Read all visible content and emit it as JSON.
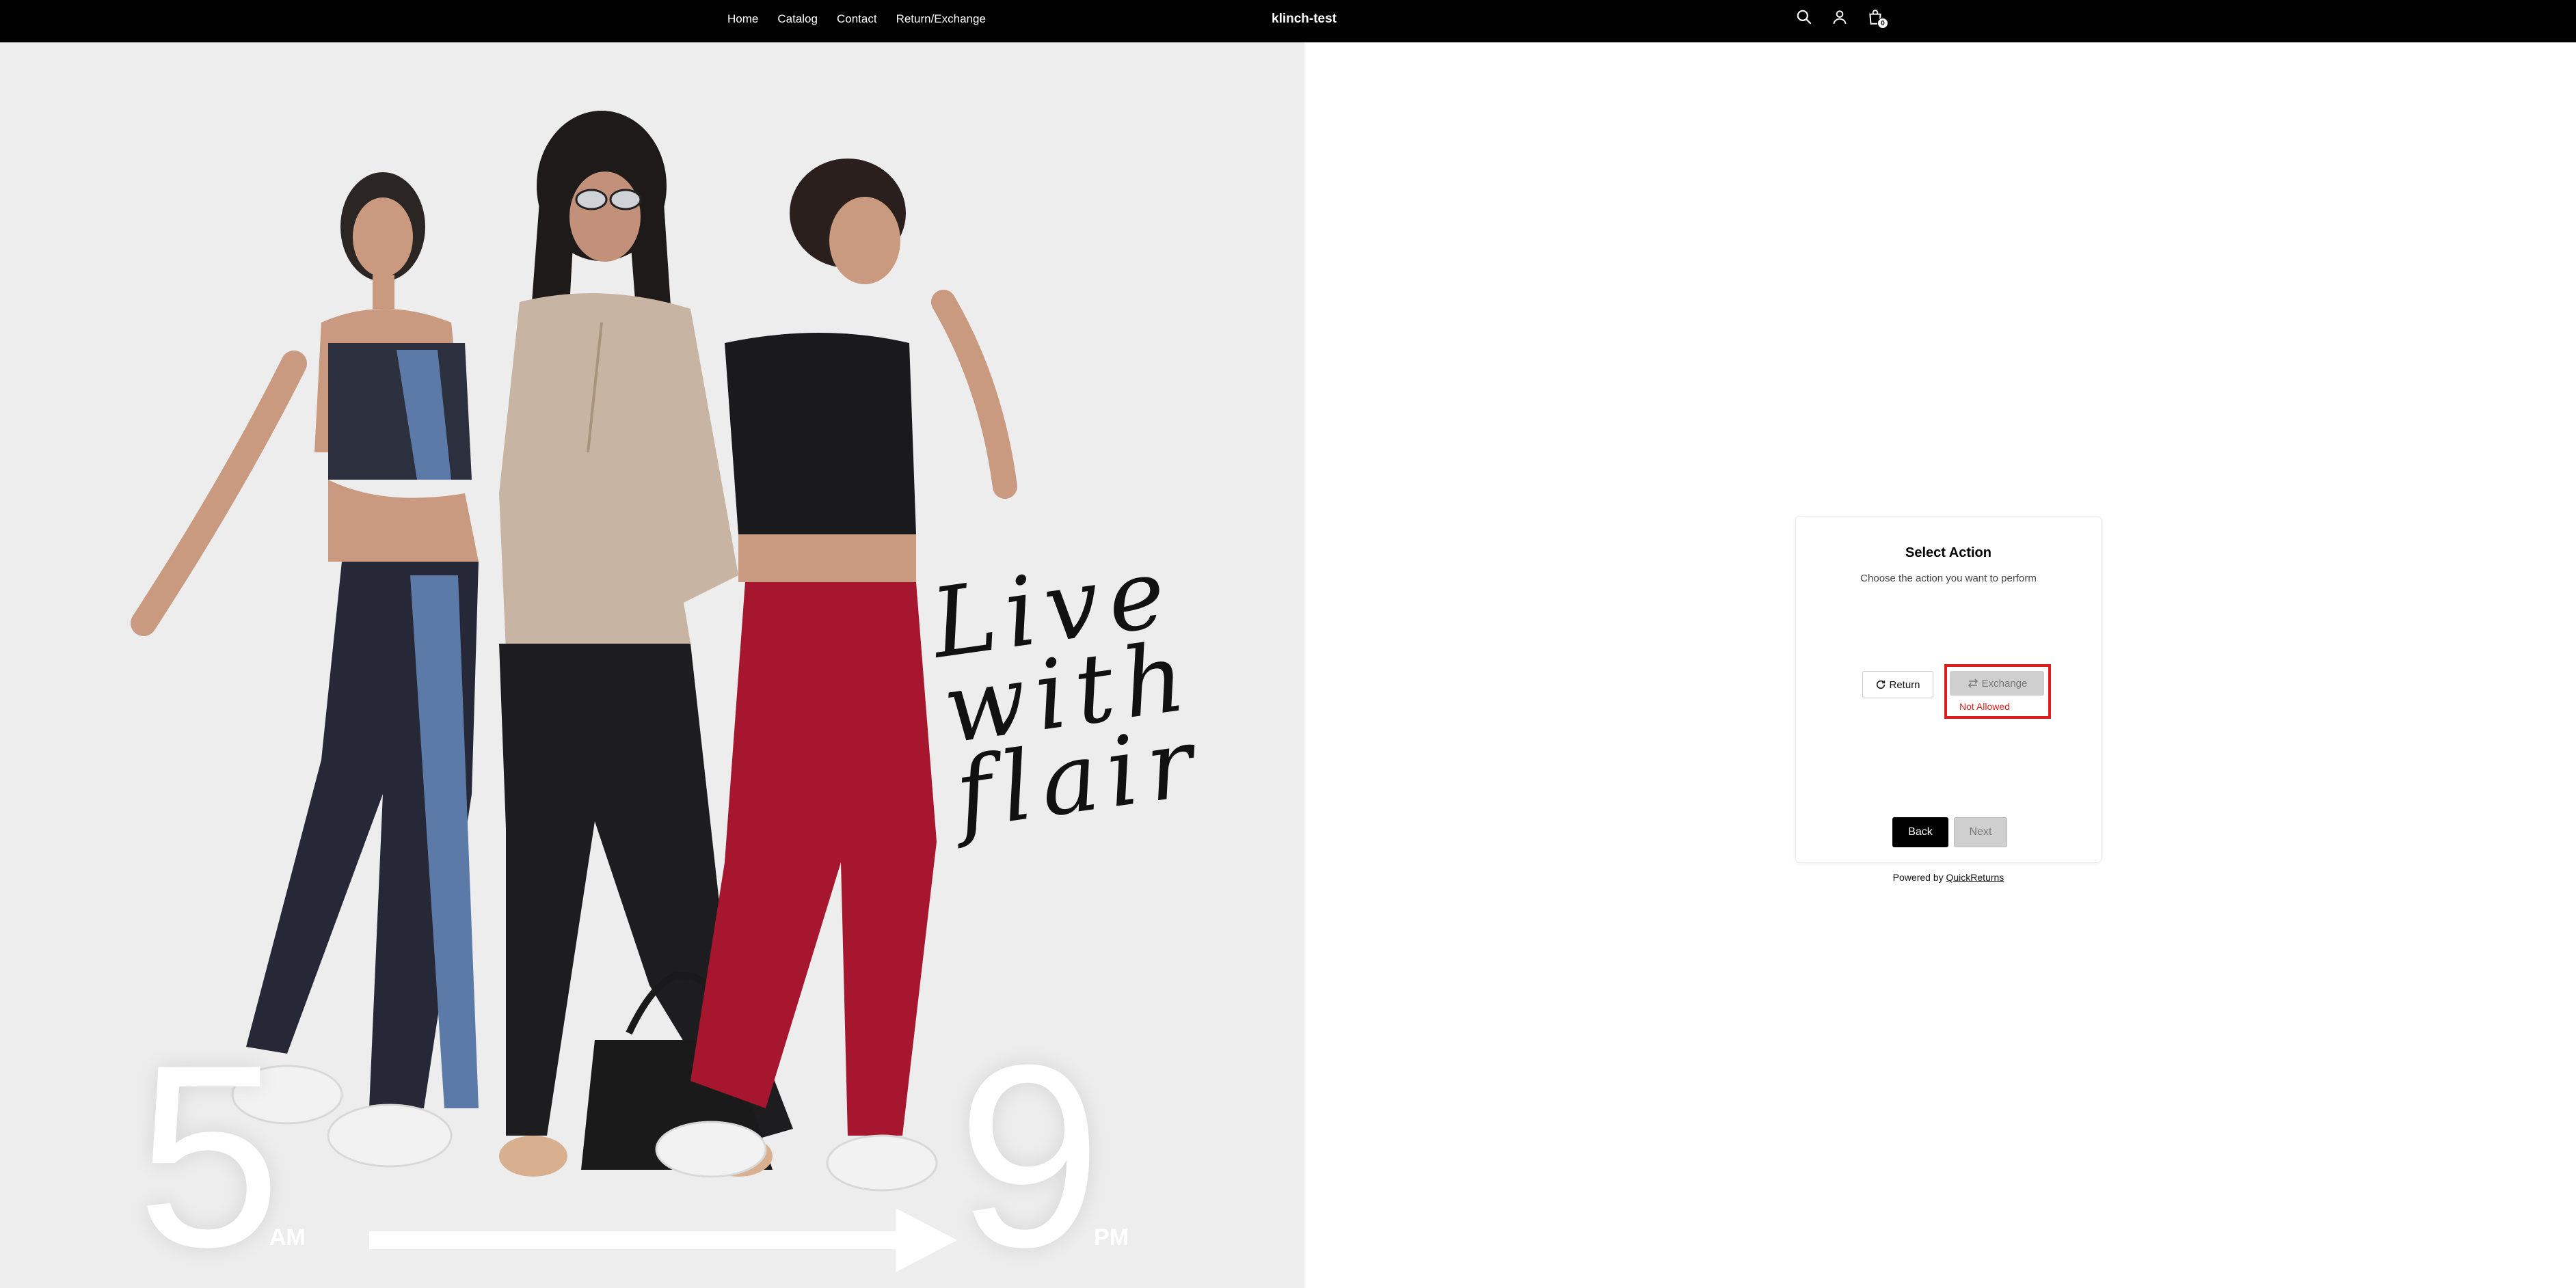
{
  "header": {
    "nav": [
      {
        "label": "Home"
      },
      {
        "label": "Catalog"
      },
      {
        "label": "Contact"
      },
      {
        "label": "Return/Exchange"
      }
    ],
    "brand": "klinch-test",
    "icons": [
      "search-icon",
      "account-icon",
      "cart-icon"
    ],
    "cart_count": "0"
  },
  "hero": {
    "script_text": [
      "Live",
      "with",
      "flair"
    ],
    "start_number": "5",
    "start_suffix": "AM",
    "end_number": "9",
    "end_suffix": "PM"
  },
  "modal": {
    "title": "Select Action",
    "subtitle": "Choose the action you want to perform",
    "return_label": "Return",
    "exchange_label": "Exchange",
    "exchange_status": "Not Allowed",
    "back_label": "Back",
    "next_label": "Next",
    "status_color": "#e01d1d"
  },
  "footer": {
    "powered_by": "Powered by",
    "powered_link": "QuickReturns"
  }
}
